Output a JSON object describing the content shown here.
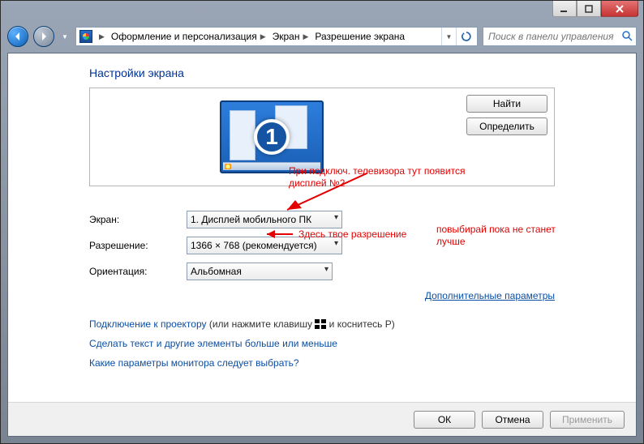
{
  "window": {
    "breadcrumb": [
      "Оформление и персонализация",
      "Экран",
      "Разрешение экрана"
    ],
    "search_placeholder": "Поиск в панели управления"
  },
  "page": {
    "title": "Настройки экрана",
    "monitor_number": "1",
    "detect_btn": "Найти",
    "identify_btn": "Определить"
  },
  "form": {
    "display_label": "Экран:",
    "display_value": "1. Дисплей мобильного ПК",
    "resolution_label": "Разрешение:",
    "resolution_value": "1366 × 768 (рекомендуется)",
    "orientation_label": "Ориентация:",
    "orientation_value": "Альбомная",
    "advanced_link": "Дополнительные параметры"
  },
  "links": {
    "projector": "Подключение к проектору",
    "projector_note_before": " (или нажмите клавишу ",
    "projector_note_after": " и коснитесь P)",
    "textsize": "Сделать текст и другие элементы больше или меньше",
    "which_settings": "Какие параметры монитора следует выбрать?"
  },
  "buttons": {
    "ok": "ОК",
    "cancel": "Отмена",
    "apply": "Применить"
  },
  "annotations": {
    "anno1": "При подключ. телевизора тут появится дисплей №2",
    "anno2": "Здесь твое разрешение",
    "anno3": "повыбирай пока не станет лучше"
  }
}
